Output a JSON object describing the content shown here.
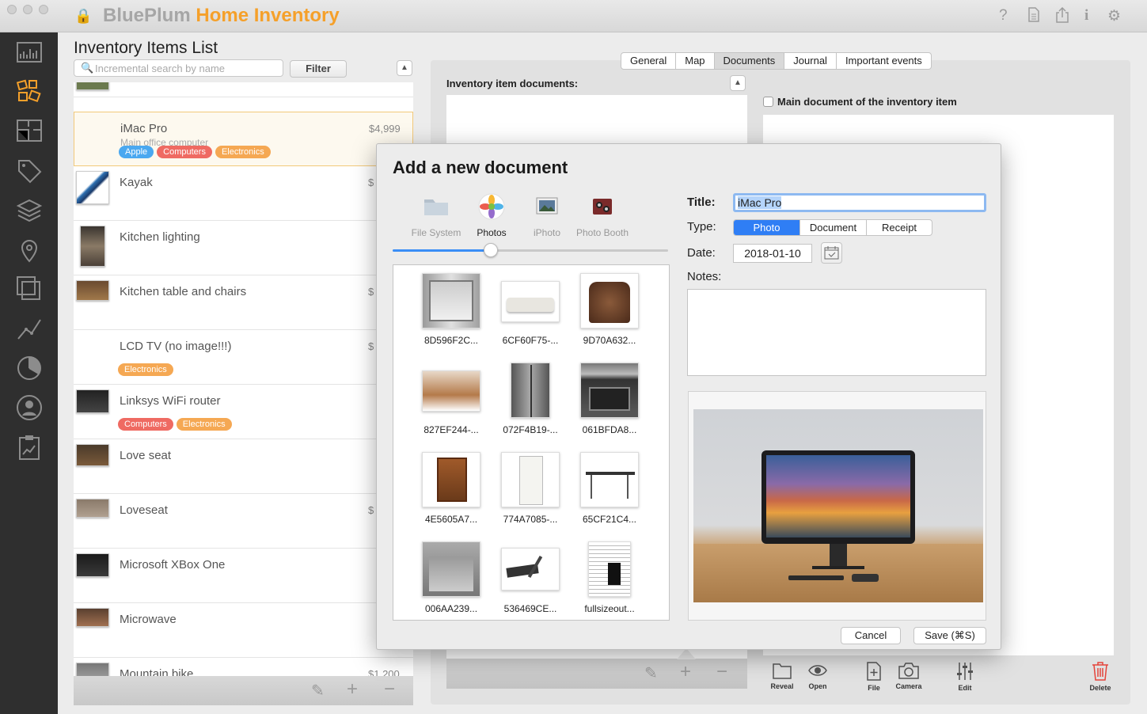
{
  "app": {
    "brand_first": "BluePlum",
    "brand_second": "Home Inventory"
  },
  "list": {
    "title": "Inventory Items List",
    "search_placeholder": "Incremental search by name",
    "filter_label": "Filter",
    "items": [
      {
        "name": "iMac Pro",
        "sub": "Main office computer",
        "price": "$4,999",
        "tags": [
          "Apple",
          "Computers",
          "Electronics"
        ]
      },
      {
        "name": "Kayak",
        "sub": "",
        "price": "$",
        "tags": []
      },
      {
        "name": "Kitchen lighting",
        "sub": "",
        "price": "",
        "tags": []
      },
      {
        "name": "Kitchen table and chairs",
        "sub": "",
        "price": "$",
        "tags": []
      },
      {
        "name": "LCD TV (no image!!!)",
        "sub": "",
        "price": "$",
        "tags": [
          "Electronics"
        ]
      },
      {
        "name": "Linksys WiFi router",
        "sub": "",
        "price": "",
        "tags": [
          "Computers",
          "Electronics"
        ]
      },
      {
        "name": "Love seat",
        "sub": "",
        "price": "",
        "tags": []
      },
      {
        "name": "Loveseat",
        "sub": "",
        "price": "$",
        "tags": []
      },
      {
        "name": "Microsoft XBox One",
        "sub": "",
        "price": "",
        "tags": []
      },
      {
        "name": "Microwave",
        "sub": "",
        "price": "",
        "tags": []
      },
      {
        "name": "Mountain bike",
        "sub": "",
        "price": "$1,200",
        "tags": []
      }
    ],
    "tag_colors": {
      "Apple": "#4aa8f0",
      "Computers": "#ef6a62",
      "Electronics": "#f5a853"
    }
  },
  "tabs": [
    "General",
    "Map",
    "Documents",
    "Journal",
    "Important events"
  ],
  "active_tab": "Documents",
  "documents": {
    "label": "Inventory item documents:",
    "main_doc_label": "Main document of the inventory item"
  },
  "right_toolbar": [
    "Reveal",
    "Open",
    "File",
    "Camera",
    "Edit",
    "Delete"
  ],
  "dialog": {
    "title": "Add a new document",
    "sources": [
      "File System",
      "Photos",
      "iPhoto",
      "Photo Booth"
    ],
    "active_source": "Photos",
    "photos": [
      "8D596F2C...",
      "6CF60F75-...",
      "9D70A632...",
      "827EF244-...",
      "072F4B19-...",
      "061BFDA8...",
      "4E5605A7...",
      "774A7085-...",
      "65CF21C4...",
      "006AA239...",
      "536469CE...",
      "fullsizeout..."
    ],
    "title_label": "Title:",
    "title_value": "iMac Pro",
    "type_label": "Type:",
    "types": [
      "Photo",
      "Document",
      "Receipt"
    ],
    "active_type": "Photo",
    "date_label": "Date:",
    "date_value": "2018-01-10",
    "notes_label": "Notes:",
    "cancel_label": "Cancel",
    "save_label": "Save (⌘S)"
  },
  "colors": {
    "accent": "#2f7ef5",
    "brand_orange": "#f5a02a",
    "sidebar_bg": "#2f2f2f"
  }
}
